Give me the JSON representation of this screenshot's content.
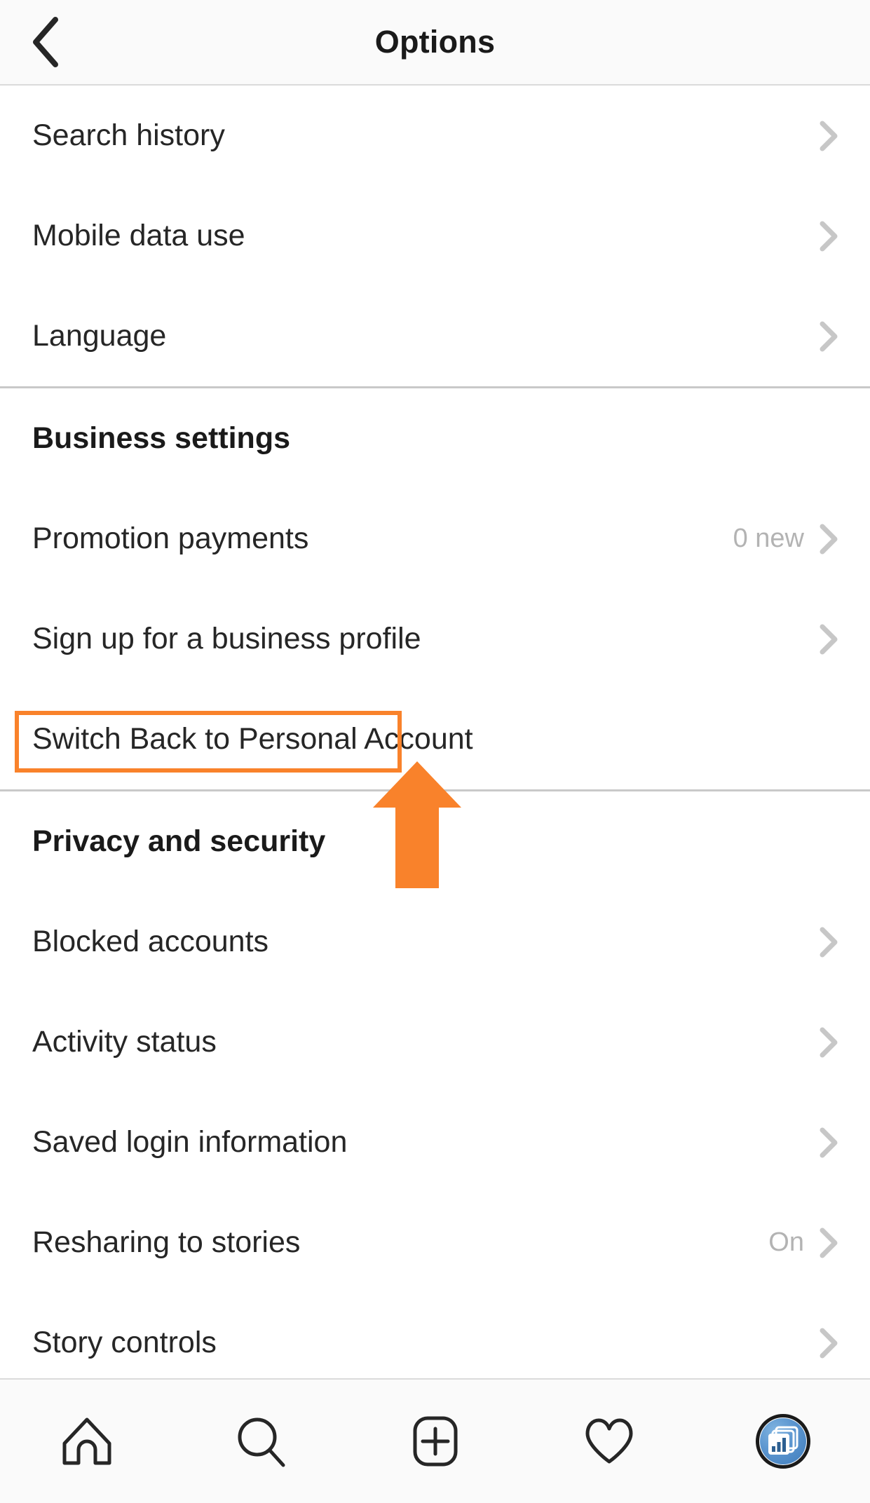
{
  "header": {
    "title": "Options",
    "back_icon": "chevron-left-icon"
  },
  "sections": [
    {
      "id": "general",
      "heading": null,
      "items": [
        {
          "label": "Search history",
          "value": "",
          "accessory": "chevron-right-icon"
        },
        {
          "label": "Mobile data use",
          "value": "",
          "accessory": "chevron-right-icon"
        },
        {
          "label": "Language",
          "value": "",
          "accessory": "chevron-right-icon"
        }
      ]
    },
    {
      "id": "business-settings",
      "heading": "Business settings",
      "items": [
        {
          "label": "Promotion payments",
          "value": "0 new",
          "accessory": "chevron-right-icon"
        },
        {
          "label": "Sign up for a business profile",
          "value": "",
          "accessory": "chevron-right-icon"
        },
        {
          "label": "Switch Back to Personal Account",
          "value": "",
          "accessory": "none"
        }
      ]
    },
    {
      "id": "privacy-and-security",
      "heading": "Privacy and security",
      "items": [
        {
          "label": "Blocked accounts",
          "value": "",
          "accessory": "chevron-right-icon"
        },
        {
          "label": "Activity status",
          "value": "",
          "accessory": "chevron-right-icon"
        },
        {
          "label": "Saved login information",
          "value": "",
          "accessory": "chevron-right-icon"
        },
        {
          "label": "Resharing to stories",
          "value": "On",
          "accessory": "chevron-right-icon"
        },
        {
          "label": "Story controls",
          "value": "",
          "accessory": "chevron-right-icon"
        }
      ]
    }
  ],
  "annotation": {
    "highlight_target": "Switch Back to Personal Account",
    "box_color": "#f9822b",
    "arrow_color": "#f9822b",
    "arrow_icon": "up-arrow-icon"
  },
  "tabbar": {
    "items": [
      {
        "name": "home",
        "icon": "home-icon",
        "selected": false
      },
      {
        "name": "search",
        "icon": "search-icon",
        "selected": false
      },
      {
        "name": "create",
        "icon": "plus-square-icon",
        "selected": false
      },
      {
        "name": "activity",
        "icon": "heart-icon",
        "selected": false
      },
      {
        "name": "profile",
        "icon": "profile-avatar-icon",
        "selected": true
      }
    ]
  },
  "colors": {
    "accent_orange": "#f9822b",
    "text_primary": "#262626",
    "text_muted": "#b3b3b3",
    "divider": "#dbdbdb",
    "chrome_bg": "#fafafa"
  }
}
